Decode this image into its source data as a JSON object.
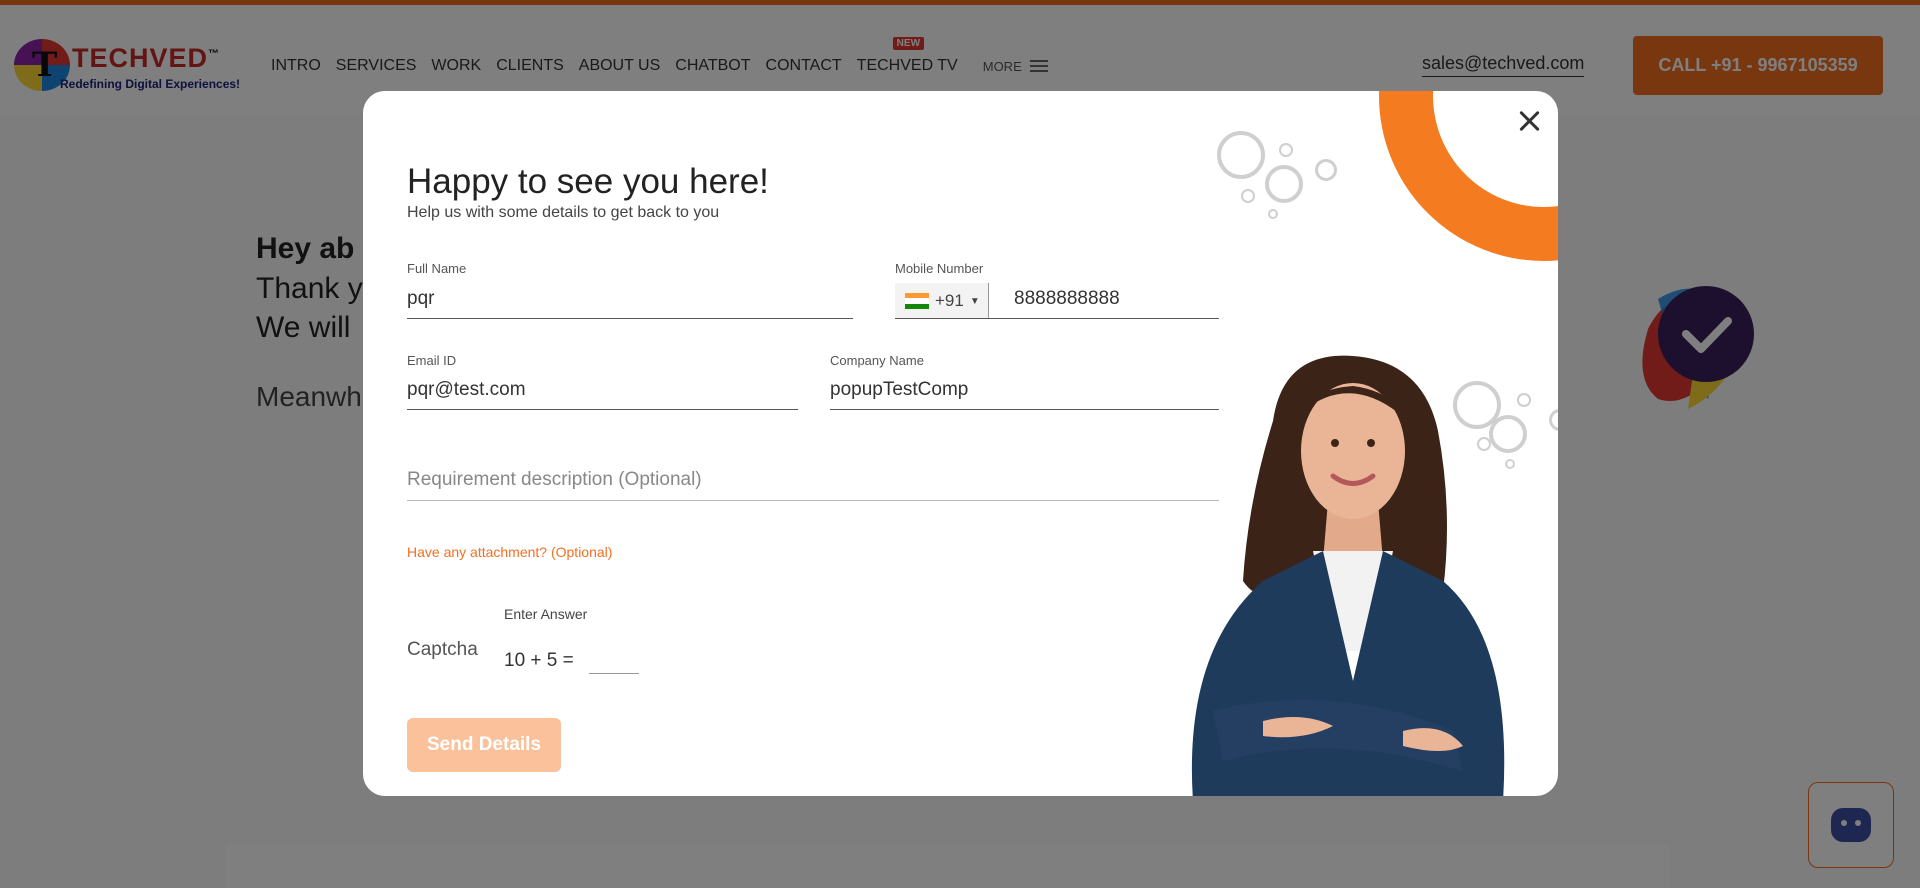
{
  "header": {
    "logo_text": "TECHVED",
    "logo_tm": "™",
    "logo_tagline": "Redefining Digital Experiences!",
    "nav": [
      "INTRO",
      "SERVICES",
      "WORK",
      "CLIENTS",
      "ABOUT US",
      "CHATBOT",
      "CONTACT",
      "TECHVED TV"
    ],
    "nav_badge": "NEW",
    "more_label": "MORE",
    "email": "sales@techved.com",
    "call_label": "CALL +91 - 9967105359"
  },
  "background_page": {
    "thanks_title": "Hey ab",
    "thanks_line1": "Thank y",
    "thanks_line2": "We will",
    "meanwhile": "Meanwh"
  },
  "modal": {
    "heading": "Happy to see you here!",
    "subheading": "Help us with some details to get back to you",
    "full_name": {
      "label": "Full Name",
      "value": "pqr"
    },
    "mobile": {
      "label": "Mobile Number",
      "country_code": "+91",
      "value": "8888888888"
    },
    "email": {
      "label": "Email ID",
      "value": "pqr@test.com"
    },
    "company": {
      "label": "Company Name",
      "value": "popupTestComp"
    },
    "requirement": {
      "placeholder": "Requirement description (Optional)"
    },
    "attachment_link": "Have any attachment? (Optional)",
    "captcha": {
      "label": "Captcha",
      "hint": "Enter Answer",
      "question": "10 + 5  ="
    },
    "submit_label": "Send Details"
  },
  "colors": {
    "accent": "#f26f21",
    "ring": "#f47b20",
    "submit_disabled": "#fbc19b"
  },
  "icons": {
    "close": "close-icon",
    "flag": "india-flag-icon",
    "check": "check-badge-icon",
    "chatbot": "chatbot-icon",
    "menu": "hamburger-icon"
  }
}
